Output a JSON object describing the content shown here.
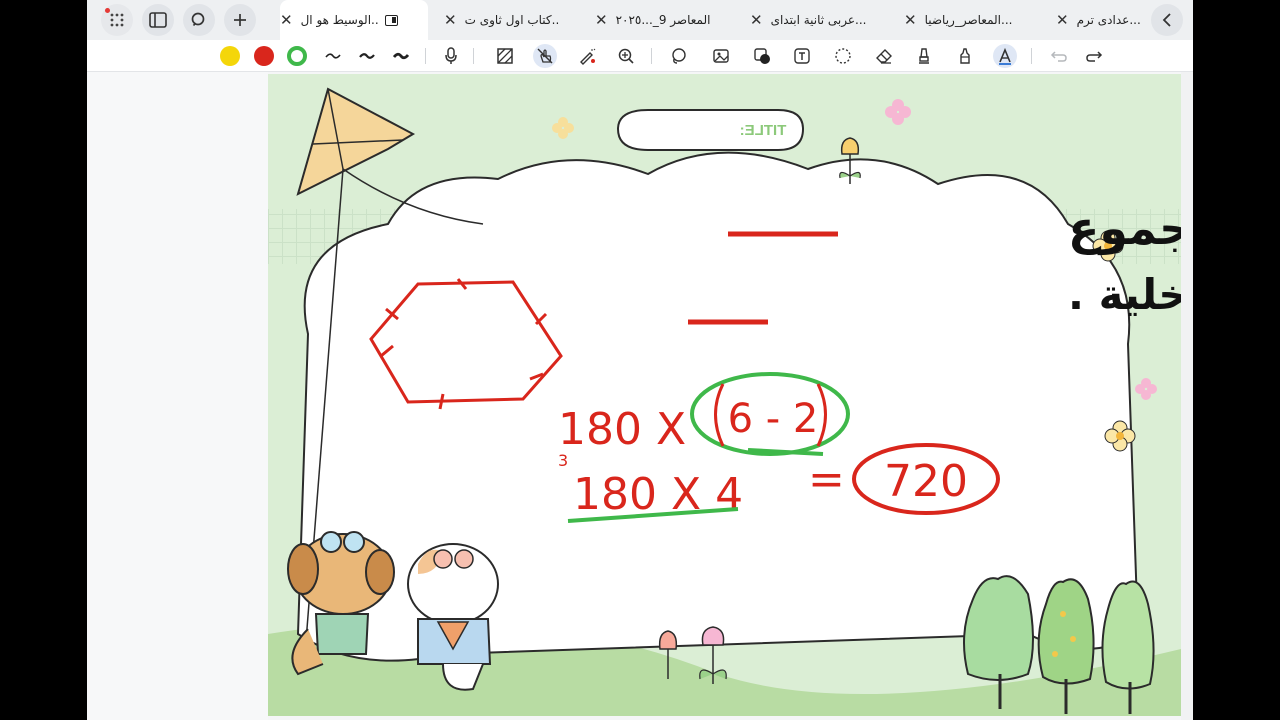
{
  "tabs": [
    {
      "label": "عدادى ترم...",
      "active": false
    },
    {
      "label": "المعاصر_رياضيا...",
      "active": false
    },
    {
      "label": "عربى ثانية ابتداى...",
      "active": false
    },
    {
      "label": "المعاصر 9_...٢٠٢٥",
      "active": false
    },
    {
      "label": "كتاب اول ثاوى ت..",
      "active": false
    },
    {
      "label": "الوسيط هو ال..",
      "active": true
    }
  ],
  "toolbar": {
    "colors": [
      "#f4d60a",
      "#d9261c",
      "#3fb84a"
    ],
    "tools": [
      "pen-stroke-1-icon",
      "pen-stroke-2-icon",
      "pen-stroke-3-icon",
      "microphone-icon",
      "hatch-icon",
      "touch-draw-icon",
      "magic-pen-icon",
      "zoom-in-icon",
      "lasso-icon",
      "image-icon",
      "shape-icon",
      "text-box-icon",
      "selection-icon",
      "eraser-icon",
      "highlighter-icon",
      "marker-icon",
      "text-icon",
      "undo-icon",
      "redo-icon"
    ]
  },
  "canvas": {
    "title_tag": "TITLE:",
    "question_line1": "شكل سداسى اوجد مجموع",
    "question_line2": "قياسات زواياه الداخلية .",
    "eq1_left": "180 X",
    "eq1_paren": "6 - 2",
    "eq2_left": "180 X 4",
    "equals": "=",
    "result": "720",
    "small_mark": "3"
  }
}
